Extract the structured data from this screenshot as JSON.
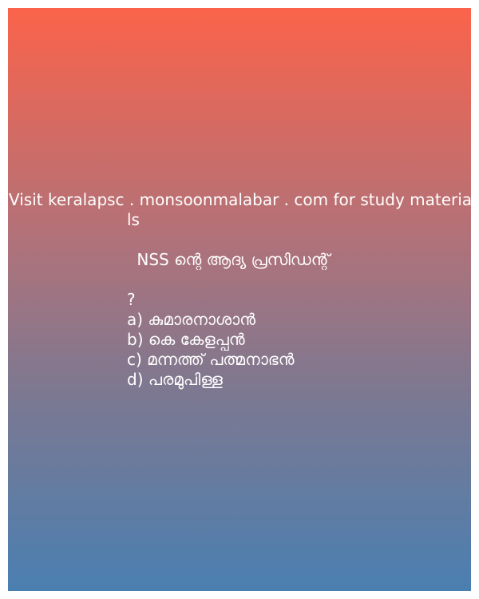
{
  "promo": {
    "line1": "Visit keralapsc . monsoonmalabar . com for study materia",
    "line2": "ls"
  },
  "question": {
    "text": " NSS ന്റെ ആദ്യ പ്രസിഡന്റ്",
    "mark": "?"
  },
  "options": [
    "a) കുമാരനാശാൻ",
    "b) കെ കേളപ്പൻ",
    "c) മന്നത്ത് പത്മനാഭൻ",
    "d) പരമുപിള്ള"
  ]
}
